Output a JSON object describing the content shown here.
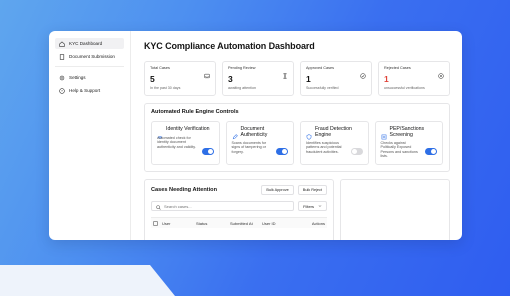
{
  "sidebar": {
    "items": [
      {
        "label": "KYC Dashboard",
        "icon": "home-icon",
        "active": true
      },
      {
        "label": "Document Submission",
        "icon": "document-icon",
        "active": false
      }
    ],
    "footer_items": [
      {
        "label": "Settings",
        "icon": "gear-icon"
      },
      {
        "label": "Help & Support",
        "icon": "help-circle-icon"
      }
    ]
  },
  "header": {
    "title": "KYC Compliance Automation Dashboard"
  },
  "stats": [
    {
      "label": "Total Cases",
      "value": "5",
      "sub": "In the past 30 days",
      "icon": "inbox-icon",
      "value_color": "#111111"
    },
    {
      "label": "Pending Review",
      "value": "3",
      "sub": "awaiting attention",
      "icon": "hourglass-icon",
      "value_color": "#111111"
    },
    {
      "label": "Approved Cases",
      "value": "1",
      "sub": "Successfully verified",
      "icon": "check-circle-icon",
      "value_color": "#111111"
    },
    {
      "label": "Rejected Cases",
      "value": "1",
      "sub": "unsuccessful verifications",
      "icon": "x-circle-icon",
      "value_color": "#e0443a"
    }
  ],
  "rules": {
    "title": "Automated Rule Engine Controls",
    "items": [
      {
        "name": "Identity Verification",
        "desc": "Automated check for identity document authenticity and validity.",
        "icon": "fingerprint-icon",
        "enabled": true
      },
      {
        "name": "Document Authenticity",
        "desc": "Scans documents for signs of tampering or forgery.",
        "icon": "pen-icon",
        "enabled": true
      },
      {
        "name": "Fraud Detection Engine",
        "desc": "Identifies suspicious patterns and potential fraudulent activities.",
        "icon": "shield-icon",
        "enabled": false
      },
      {
        "name": "PEP/Sanctions Screening",
        "desc": "Checks against Politically Exposed Persons and sanctions lists.",
        "icon": "list-icon",
        "enabled": true
      }
    ]
  },
  "cases": {
    "title": "Cases Needing Attention",
    "bulk_approve": "Bulk Approve",
    "bulk_reject": "Bulk Reject",
    "search_placeholder": "Search cases...",
    "filters_label": "Filters",
    "columns": [
      "User",
      "Status",
      "Submitted At",
      "User ID",
      "Actions"
    ]
  },
  "colors": {
    "accent": "#2e6fe6",
    "danger": "#e0443a",
    "background": "#3a6ff0"
  }
}
